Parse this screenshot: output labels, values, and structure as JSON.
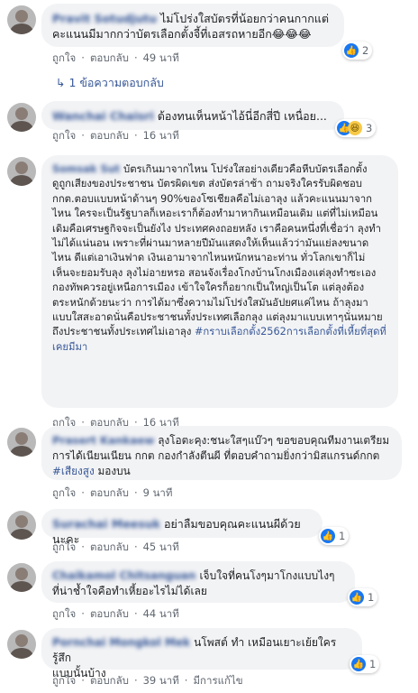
{
  "labels": {
    "like": "ถูกใจ",
    "reply": "ตอบกลับ",
    "dot": "·",
    "edited": "มีการแก้ไข"
  },
  "comments": [
    {
      "name": "Pravit Sotudjutu",
      "text": "ไม่โปร่งใสบัตรที่น้อยกว่าคนกากแต่\nคะแนนมีมากกว่าบัตรเลือกตั้งจี้ที่เอสรถหายอีก😂😂😂",
      "time": "49 นาที",
      "reactions": "2"
    },
    {
      "replies": "1 ข้อความตอบกลับ"
    },
    {
      "name": "Wanchai Chaisri",
      "text": "ต้องทนเห็นหน้าไอ้นี่อีกสี่ปี เหนื่อย...",
      "time": "16 นาที",
      "reactions": "3"
    },
    {
      "name": "Somsak Sut",
      "text": "บัตรเกินมาจากไหน โปร่งใสอย่างเดียวคือหีบบัตรเลือกตั้ง ดูถูกเสียงของประชาชน บัตรผิดเขต ส่งบัตรล่าช้า ถามจริงใครรับผิดชอบ กกต.ตอบแบบหน้าด้านๆ 90%ของโซเชียลคือไม่เอาลุง แล้วคะแนนมาจากไหน ใครจะเป็นรัฐบาลก็เหอะเราก็ต้องทำมาหากินเหมือนเดิม แต่ที่ไม่เหมือนเดิมคือเศรษฐกิจจะเป็นยังไง ประเทศคงถอยหลัง เราคือคนหนึ่งที่เชื่อว่า ลุงทำไม่ได้แน่นอน เพราะที่ผ่านมาหลายปีมันแสดงให้เห็นแล้วว่ามันแย่ลงขนาดไหน ดีแต่เอาเงินฟาด เงินเอามาจากไหนหนักหนาอะท่าน ทั่วโลกเขาก็ไม่เห็นจะยอมรับลุง ลุงไม่อายหรอ สอนจังเรื่องโกงบ้านโกงเมืองแต่ลุงทำซะเองกองทัพควรอยู่เหนือการเมือง เข้าใจใครก็อยากเป็นใหญ่เป็นโต แต่ลุงต้องตระหนักด้วยนะว่า การได้มาซึ่งความไม่โปร่งใสมันอัปยศแค่ไหน ถ้าลุงมาแบบใสสะอาดนั่นคือประชาชนทั้งประเทศเลือกลุง แต่ลุงมาแบบเทาๆนั่นหมายถึงประชาชนทั้งประเทศไม่เอาลุง ",
      "hashtag": "#กราบเลือกตั้ง2562การเลือกตั้งที่เหี้ยที่สุดที่เคยมีมา",
      "time": "16 นาที"
    },
    {
      "name": "Prasert Kankaew",
      "text": "ลุงโอตะคุง:ชนะใสๆแบ๊วๆ ขอขอบคุณทีมงานเตรียมการได้เนียนเนียน กกต กองกำลังตีนผี ที่ตอบคำถามยิ่งกว่ามิสแกรนด์กกต ",
      "hashtag": "#เสียงสูง",
      "text2": " มองบน",
      "time": "9 นาที"
    },
    {
      "name": "Surachai Meesuk",
      "text": "อย่าลืมขอบคุณคะแนนผีด้วยนะคะ",
      "time": "45 นาที",
      "reactions": "1"
    },
    {
      "name": "Chaikamol Chitsanguan",
      "text": "เจ็บใจที่คนโงๆมาโกงแบบไงๆ\nที่น่าช้ำใจคือทำเหี้ยอะไรไม่ได้เลย",
      "time": "44 นาที",
      "reactions": "1"
    },
    {
      "name": "Pornchai Mongkol Mek",
      "text": "นโพสต์ ทำ เหมือนเยาะเย้ยใครรู้สึก\nแบบนั้นบ้าง",
      "time": "39 นาที",
      "reactions": "1"
    }
  ]
}
